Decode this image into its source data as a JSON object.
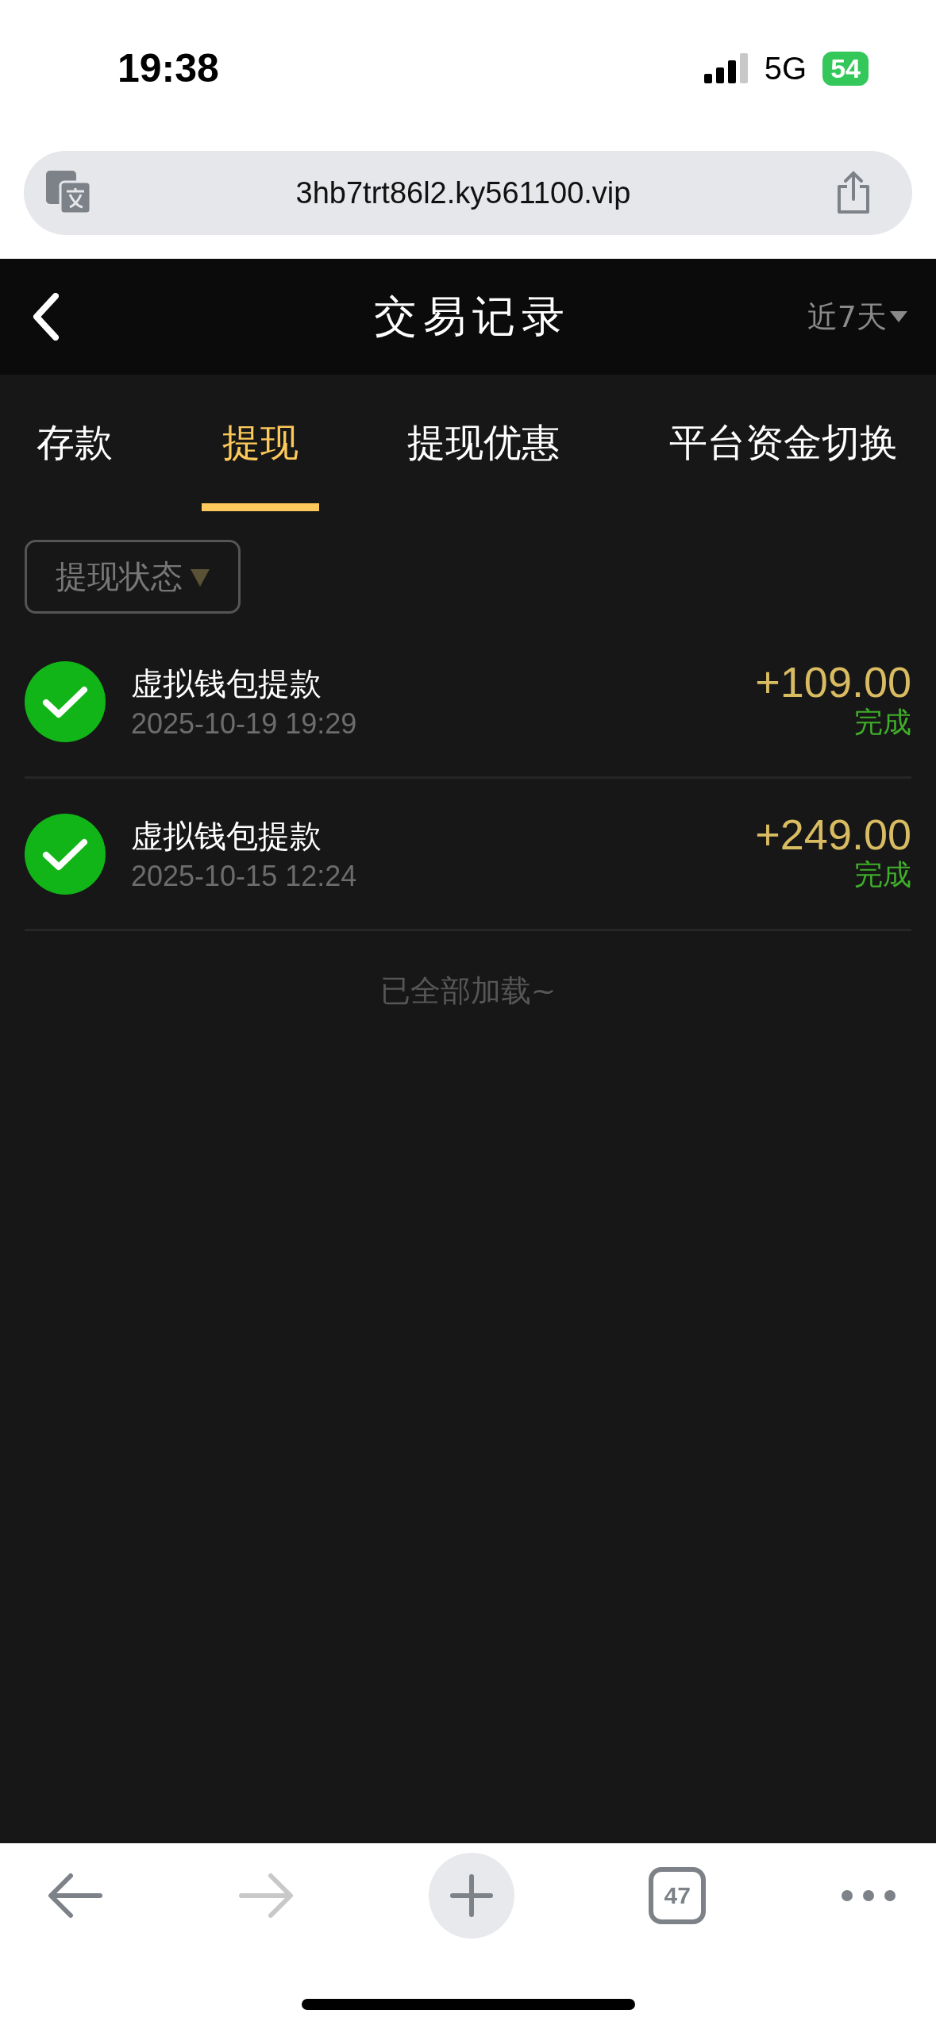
{
  "status_bar": {
    "time": "19:38",
    "network": "5G",
    "battery": "54"
  },
  "browser": {
    "url": "3hb7trt86l2.ky561100.vip",
    "tab_count": "47",
    "forward_disabled": true
  },
  "header": {
    "title": "交易记录",
    "range": "近7天"
  },
  "tabs": [
    {
      "label": "存款",
      "selected": false
    },
    {
      "label": "提现",
      "selected": true
    },
    {
      "label": "提现优惠",
      "selected": false
    },
    {
      "label": "平台资金切换",
      "selected": false
    }
  ],
  "filter": {
    "label": "提现状态"
  },
  "records": [
    {
      "title": "虚拟钱包提款",
      "time": "2025-10-19 19:29",
      "amount": "+109.00",
      "status": "完成",
      "kind": "success"
    },
    {
      "title": "虚拟钱包提款",
      "time": "2025-10-15 12:24",
      "amount": "+249.00",
      "status": "完成",
      "kind": "success"
    }
  ],
  "end_note": "已全部加载~"
}
